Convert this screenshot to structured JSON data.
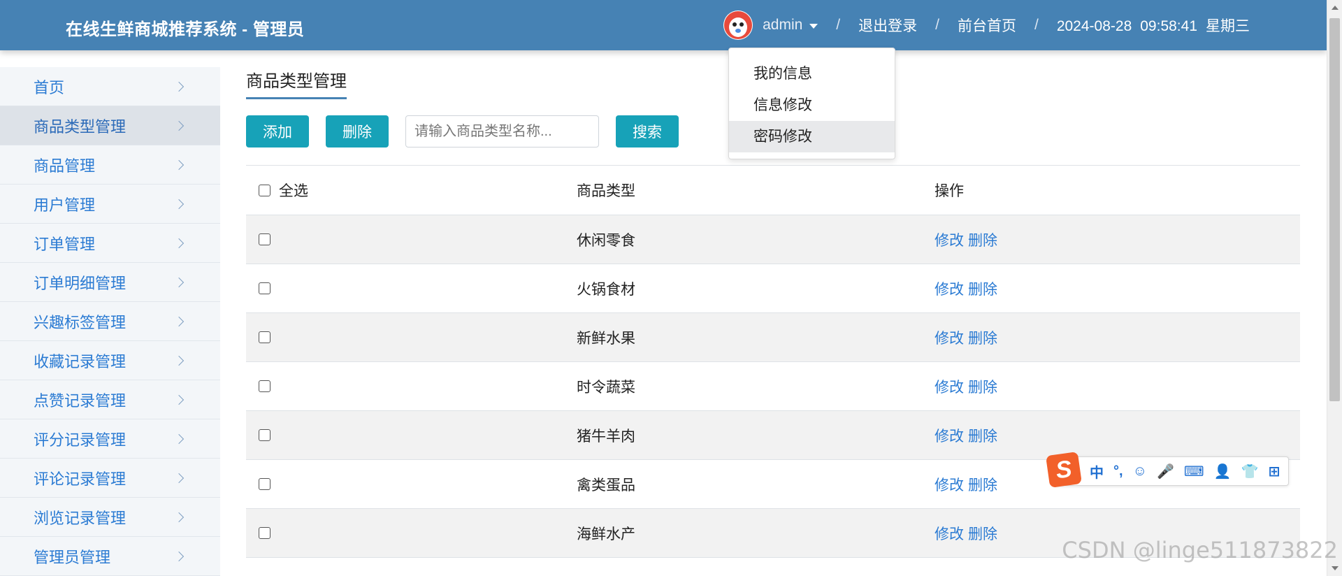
{
  "header": {
    "title": "在线生鲜商城推荐系统 - 管理员",
    "username": "admin",
    "logout": "退出登录",
    "frontpage": "前台首页",
    "separator": "/",
    "date": "2024-08-28",
    "time": "09:58:41",
    "weekday": "星期三"
  },
  "user_dropdown": {
    "items": [
      "我的信息",
      "信息修改",
      "密码修改"
    ],
    "highlighted": "密码修改"
  },
  "sidebar": {
    "items": [
      {
        "label": "首页"
      },
      {
        "label": "商品类型管理",
        "active": true
      },
      {
        "label": "商品管理"
      },
      {
        "label": "用户管理"
      },
      {
        "label": "订单管理"
      },
      {
        "label": "订单明细管理"
      },
      {
        "label": "兴趣标签管理"
      },
      {
        "label": "收藏记录管理"
      },
      {
        "label": "点赞记录管理"
      },
      {
        "label": "评分记录管理"
      },
      {
        "label": "评论记录管理"
      },
      {
        "label": "浏览记录管理"
      },
      {
        "label": "管理员管理"
      }
    ]
  },
  "main": {
    "page_title": "商品类型管理",
    "toolbar": {
      "add_label": "添加",
      "delete_label": "删除",
      "search_placeholder": "请输入商品类型名称...",
      "search_label": "搜索"
    },
    "table": {
      "columns": [
        "全选",
        "商品类型",
        "操作"
      ],
      "edit_label": "修改",
      "delete_label": "删除",
      "rows": [
        {
          "type": "休闲零食"
        },
        {
          "type": "火锅食材"
        },
        {
          "type": "新鲜水果"
        },
        {
          "type": "时令蔬菜"
        },
        {
          "type": "猪牛羊肉"
        },
        {
          "type": "禽类蛋品"
        },
        {
          "type": "海鲜水产"
        }
      ]
    }
  },
  "ime_toolbar": {
    "logo": "S",
    "items": [
      "中",
      "°,",
      "☺",
      "🎤",
      "⌨",
      "👤",
      "👕",
      "⊞"
    ]
  },
  "watermark": "CSDN @linge511873822",
  "colors": {
    "header_bg": "#4682b4",
    "button": "#17a2b8",
    "link": "#2b7bd3",
    "sidebar_bg": "#f3f6f9"
  }
}
